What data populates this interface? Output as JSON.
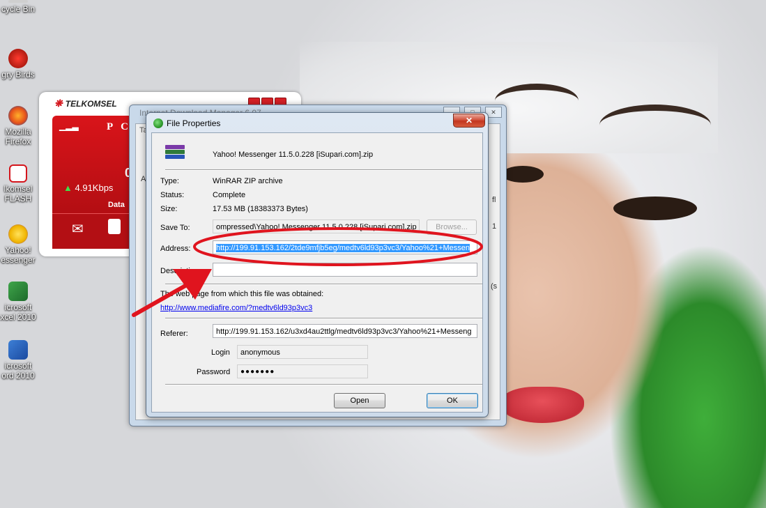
{
  "desktop": {
    "icons": [
      {
        "label": "cycle Bin",
        "icon": "recycle-bin-icon"
      },
      {
        "label": "gry Birds",
        "icon": "angry-birds-icon"
      },
      {
        "label": "Mozilla\nFirefox",
        "icon": "firefox-icon"
      },
      {
        "label": "lkomsel\nFLASH",
        "icon": "telkomsel-flash-icon"
      },
      {
        "label": "Yahoo!\nessenger",
        "icon": "yahoo-messenger-icon"
      },
      {
        "label": "icrosoft\nxcel 2010",
        "icon": "excel-icon"
      },
      {
        "label": "icrosoft\nord 2010",
        "icon": "word-icon"
      }
    ]
  },
  "telkomsel": {
    "brand": "TELKOMSEL",
    "header_letters": "P C",
    "value": "00",
    "speed": "4.91Kbps",
    "data_label": "Data"
  },
  "background_window": {
    "title": "Internet Download Manager 6.07",
    "tab_fragment": "Ta",
    "left_fragment": "A",
    "right_fragments": [
      "fl",
      "1",
      "(s"
    ]
  },
  "dialog": {
    "title": "File Properties",
    "close_glyph": "✕",
    "file_name": "Yahoo! Messenger 11.5.0.228 [iSupari.com].zip",
    "labels": {
      "type": "Type:",
      "status": "Status:",
      "size": "Size:",
      "save_to": "Save To:",
      "address": "Address:",
      "description": "Description:",
      "web_page": "The web page from which this file was obtained:",
      "referer": "Referer:",
      "login": "Login",
      "password": "Password"
    },
    "values": {
      "type": "WinRAR ZIP archive",
      "status": "Complete",
      "size": "17.53  MB (18383373 Bytes)",
      "save_to": "ompressed\\Yahoo! Messenger 11.5.0.228 [iSupari.com].zip",
      "address": "http://199.91.153.162/2tde9mfjb5eg/medtv6ld93p3vc3/Yahoo%21+Messen",
      "description": "",
      "web_page_link": "http://www.mediafire.com/?medtv6ld93p3vc3",
      "referer": "http://199.91.153.162/u3xd4au2ttlg/medtv6ld93p3vc3/Yahoo%21+Messeng",
      "login": "anonymous",
      "password": "●●●●●●●"
    },
    "buttons": {
      "browse": "Browse...",
      "open": "Open",
      "ok": "OK"
    }
  },
  "colors": {
    "annotation_red": "#e0141e",
    "telkomsel_red": "#d9141a",
    "selection_blue": "#3399ff",
    "link_blue": "#0000ee"
  }
}
